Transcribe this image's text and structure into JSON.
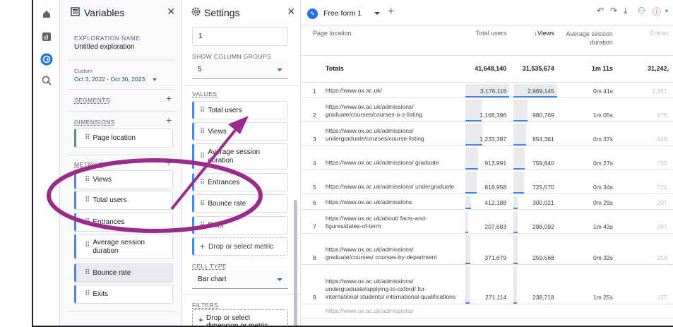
{
  "rail": {
    "icons": [
      "home-icon",
      "reports-icon",
      "explore-icon",
      "advertising-icon"
    ]
  },
  "variables": {
    "title": "Variables",
    "close": "×",
    "exploration_name_label": "EXPLORATION NAME:",
    "exploration_name": "Untitled exploration",
    "date_label": "Custom",
    "date_range": "Oct 3, 2022 - Oct 30, 2023",
    "segments_label": "SEGMENTS",
    "dimensions_label": "DIMENSIONS",
    "dimensions": [
      "Page location"
    ],
    "metrics_label": "METRICS",
    "metrics": [
      "Views",
      "Total users",
      "Entrances",
      "Average session duration",
      "Bounce rate",
      "Exits"
    ]
  },
  "settings": {
    "title": "Settings",
    "close": "×",
    "top_value": "1",
    "show_column_groups_label": "SHOW COLUMN GROUPS",
    "show_column_groups_value": "5",
    "values_label": "VALUES",
    "values": [
      "Total users",
      "Views",
      "Average session duration",
      "Entrances",
      "Bounce rate",
      "Exits"
    ],
    "drop_metric": "Drop or select metric",
    "cell_type_label": "CELL TYPE",
    "cell_type_value": "Bar chart",
    "filters_label": "FILTERS",
    "drop_dimension": "Drop or select dimension or metric"
  },
  "tab": {
    "name": "Free form 1",
    "plus": "+"
  },
  "toolbar": [
    "undo-icon",
    "redo-icon",
    "download-icon",
    "share-icon",
    "alert-icon"
  ],
  "table": {
    "headers": {
      "location": "Page location",
      "users": "Total users",
      "views": "↓Views",
      "duration": "Average session duration",
      "entrances": "Entran"
    },
    "totals": {
      "label": "Totals",
      "users": "41,648,140",
      "views": "31,535,674",
      "duration": "1m 11s",
      "entrances": "31,242,"
    },
    "rows": [
      {
        "idx": "1",
        "loc": "https://www.ox.ac.uk/",
        "users": "3,176,118",
        "views": "2,969,145",
        "duration": "0m 41s",
        "entrances": "2,957,",
        "users_frac": 1.0,
        "views_frac": 1.0
      },
      {
        "idx": "2",
        "loc": "https://www.ox.ac.uk/admissions/ graduate/courses/courses-a-z-listing",
        "users": "1,168,396",
        "views": "980,769",
        "duration": "1m 05s",
        "entrances": "976,",
        "users_frac": 0.37,
        "views_frac": 0.33
      },
      {
        "idx": "3",
        "loc": "https://www.ox.ac.uk/admissions/ undergraduate/courses/course-listing",
        "users": "1,233,387",
        "views": "854,361",
        "duration": "0m 37s",
        "entrances": "849,",
        "users_frac": 0.39,
        "views_frac": 0.29
      },
      {
        "idx": "4",
        "loc": "https://www.ox.ac.uk/admissions/ graduate",
        "users": "913,991",
        "views": "759,840",
        "duration": "0m 27s",
        "entrances": "755,",
        "users_frac": 0.29,
        "views_frac": 0.26
      },
      {
        "idx": "5",
        "loc": "https://www.ox.ac.uk/admissions/ undergraduate",
        "users": "818,958",
        "views": "725,570",
        "duration": "0m 34s",
        "entrances": "721,",
        "users_frac": 0.26,
        "views_frac": 0.24
      },
      {
        "idx": "6",
        "loc": "https://www.ox.ac.uk/admissions",
        "users": "412,188",
        "views": "300,021",
        "duration": "0m 29s",
        "entrances": "297,",
        "users_frac": 0.13,
        "views_frac": 0.1
      },
      {
        "idx": "7",
        "loc": "https://www.ox.ac.uk/about/ facts-and-figures/dates-of-term",
        "users": "207,683",
        "views": "298,092",
        "duration": "1m 43s",
        "entrances": "297,",
        "users_frac": 0.07,
        "views_frac": 0.1
      },
      {
        "idx": "8",
        "loc": "https://www.ox.ac.uk/admissions/ graduate/courses/ courses-by-department",
        "users": "371,679",
        "views": "259,568",
        "duration": "0m 32s",
        "entrances": "258,",
        "users_frac": 0.12,
        "views_frac": 0.09
      },
      {
        "idx": "9",
        "loc": "https://www.ox.ac.uk/admissions/ undergraduate/applying-to-oxford/ for-international-students/ international-qualifications",
        "users": "271,114",
        "views": "238,718",
        "duration": "1m 25s",
        "entrances": "237,",
        "users_frac": 0.09,
        "views_frac": 0.08
      }
    ],
    "partial_row_loc": "https://www.ox.ac.uk/admissions/"
  }
}
